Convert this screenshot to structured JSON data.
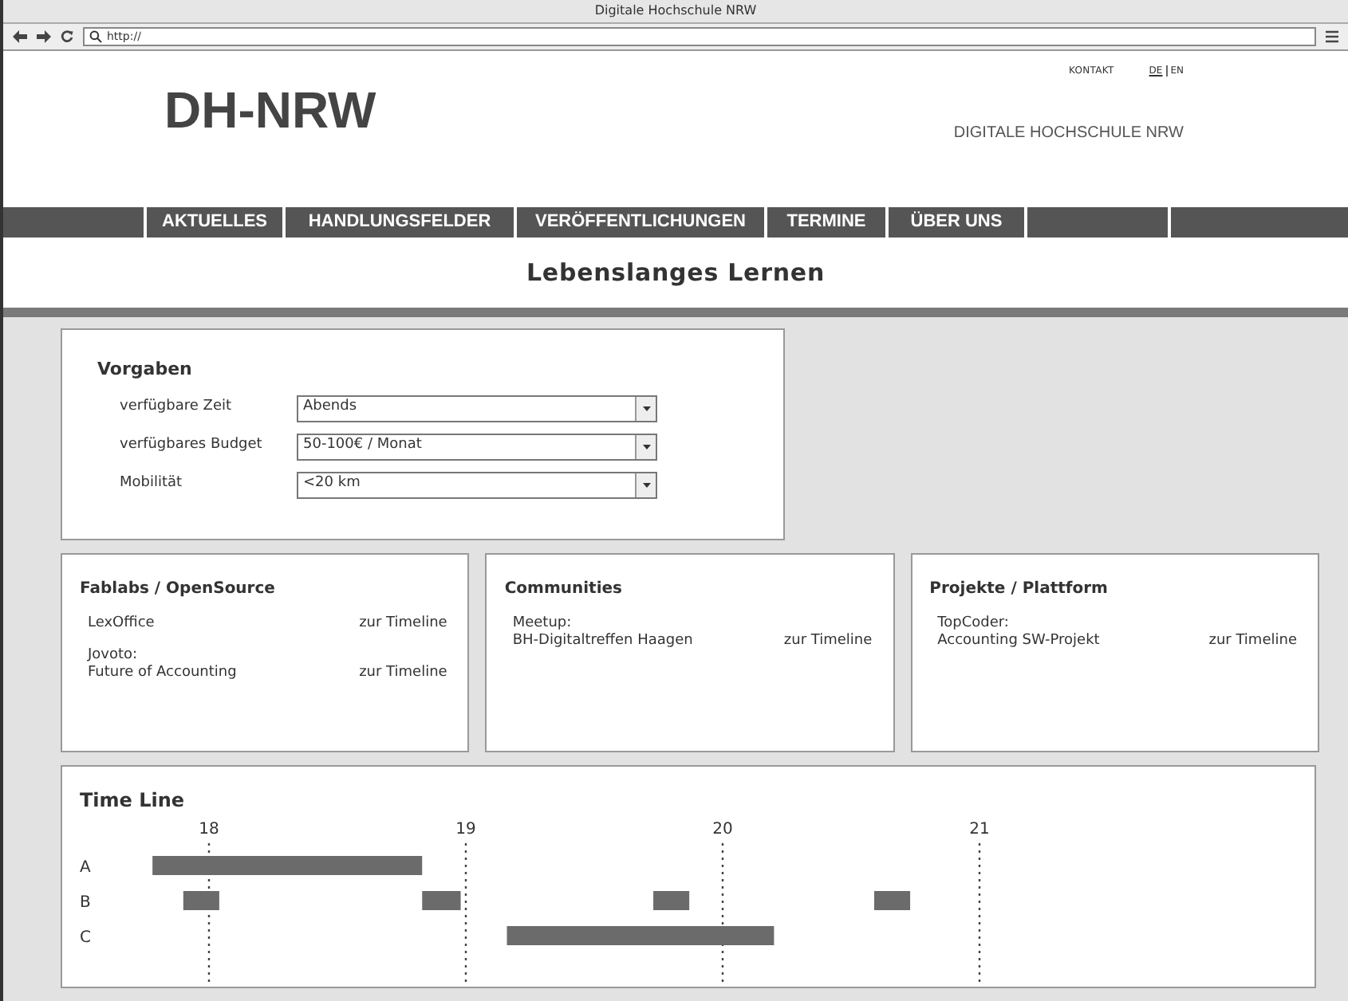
{
  "window": {
    "title": "Digitale Hochschule NRW"
  },
  "address_bar": {
    "value": "http://"
  },
  "header": {
    "links": [
      {
        "label": "KONTAKT"
      }
    ],
    "languages": [
      {
        "label": "DE",
        "selected": true
      },
      {
        "label": "EN",
        "selected": false
      }
    ],
    "logo": "DH-NRW",
    "subtitle": "DIGITALE HOCHSCHULE NRW"
  },
  "nav": [
    {
      "label": "AKTUELLES"
    },
    {
      "label": "HANDLUNGSFELDER"
    },
    {
      "label": "VERÖFFENTLICHUNGEN"
    },
    {
      "label": "TERMINE"
    },
    {
      "label": "ÜBER UNS"
    }
  ],
  "page_title": "Lebenslanges Lernen",
  "filters": {
    "title": "Vorgaben",
    "fields": [
      {
        "label": "verfügbare Zeit",
        "value": "Abends"
      },
      {
        "label": "verfügbares Budget",
        "value": "50-100€ / Monat"
      },
      {
        "label": "Mobilität",
        "value": "<20 km"
      }
    ]
  },
  "cards": [
    {
      "title": "Fablabs / OpenSource",
      "items": [
        {
          "lines": [
            "LexOffice"
          ],
          "link": "zur Timeline"
        },
        {
          "lines": [
            "Jovoto:",
            "Future of Accounting"
          ],
          "link": "zur Timeline"
        }
      ]
    },
    {
      "title": "Communities",
      "items": [
        {
          "lines": [
            "Meetup:",
            "BH-Digitaltreffen Haagen"
          ],
          "link": "zur Timeline"
        }
      ]
    },
    {
      "title": "Projekte / Plattform",
      "items": [
        {
          "lines": [
            "TopCoder:",
            "Accounting SW-Projekt"
          ],
          "link": "zur Timeline"
        }
      ]
    }
  ],
  "timeline": {
    "title": "Time Line",
    "ticks": [
      "18",
      "19",
      "20",
      "21"
    ],
    "rows": [
      {
        "label": "A"
      },
      {
        "label": "B"
      },
      {
        "label": "C"
      }
    ]
  }
}
